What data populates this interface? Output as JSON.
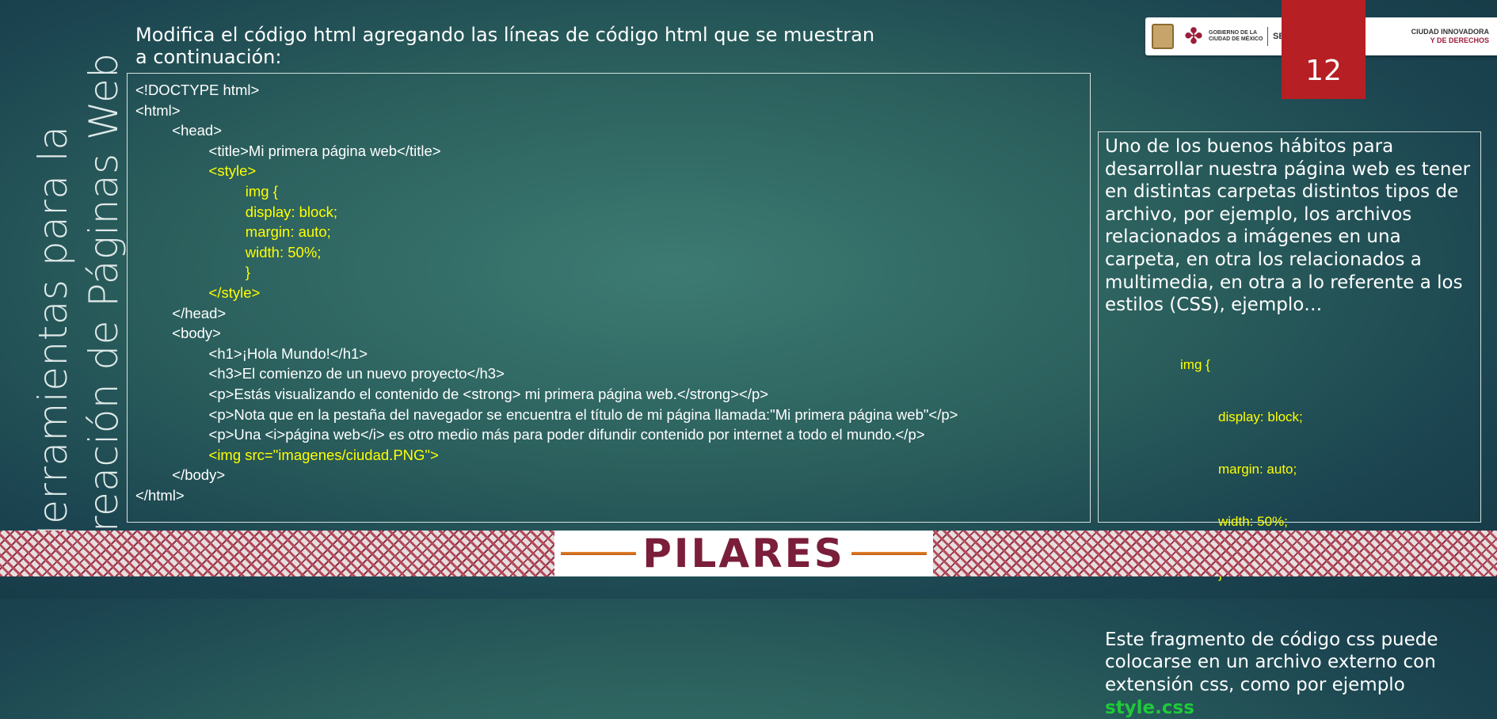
{
  "slide": {
    "title_line1": "Herramientas para la",
    "title_line2": "creación de Páginas Web",
    "instruction_line1": "Modifica el código html agregando las líneas de código html que se muestran",
    "instruction_line2": "a continuación:",
    "page_number": "12"
  },
  "header_logos": {
    "gov_label": "GOBIERNO DE LA\nCIUDAD DE MÉXICO",
    "sectei": "SECTEI",
    "ciudad_line1": "CIUDAD INNOVADORA",
    "ciudad_line2": "Y DE DERECHOS"
  },
  "code_lines": [
    "<!DOCTYPE html>",
    "<html>",
    "         <head>",
    "                  <title>Mi primera página web</title>",
    "                  <style>",
    "                           img {",
    "                           display: block;",
    "                           margin: auto;",
    "                           width: 50%;",
    "                           }",
    "                  </style>",
    "         </head>",
    "         <body>",
    "                  <h1>¡Hola Mundo!</h1>",
    "                  <h3>El comienzo de un nuevo proyecto</h3>",
    "                  <p>Estás visualizando el contenido de <strong> mi primera página web.</strong></p>",
    "                  <p>Nota que en la pestaña del navegador se encuentra el título de mi página llamada:\"Mi primera página web\"</p>",
    "                  <p>Una <i>página web</i> es otro medio más para poder difundir contenido por internet a todo el mundo.</p>",
    "                  <img src=\"imagenes/ciudad.PNG\">",
    "         </body>",
    "</html>"
  ],
  "side_panel": {
    "paragraph1": "Uno de los buenos hábitos para desarrollar nuestra página web es tener en distintas carpetas distintos tipos de archivo, por ejemplo, los archivos relacionados a imágenes en una carpeta, en otra los relacionados a multimedia, en otra a lo referente a los estilos (CSS), ejemplo…",
    "css_line1": "img {",
    "css_line2": "display: block;",
    "css_line3": "margin: auto;",
    "css_line4": "width: 50%;",
    "css_line5": "}",
    "paragraph2": "Este fragmento de código css puede colocarse en un archivo externo con extensión css, como por ejemplo",
    "file_name": "style.css"
  },
  "footer": {
    "brand": "PILARES"
  },
  "colors": {
    "highlight_code": "#ffff00",
    "file_name": "#1fc93a",
    "page_number_bg": "#b61f24",
    "brand": "#7a1e3a"
  }
}
